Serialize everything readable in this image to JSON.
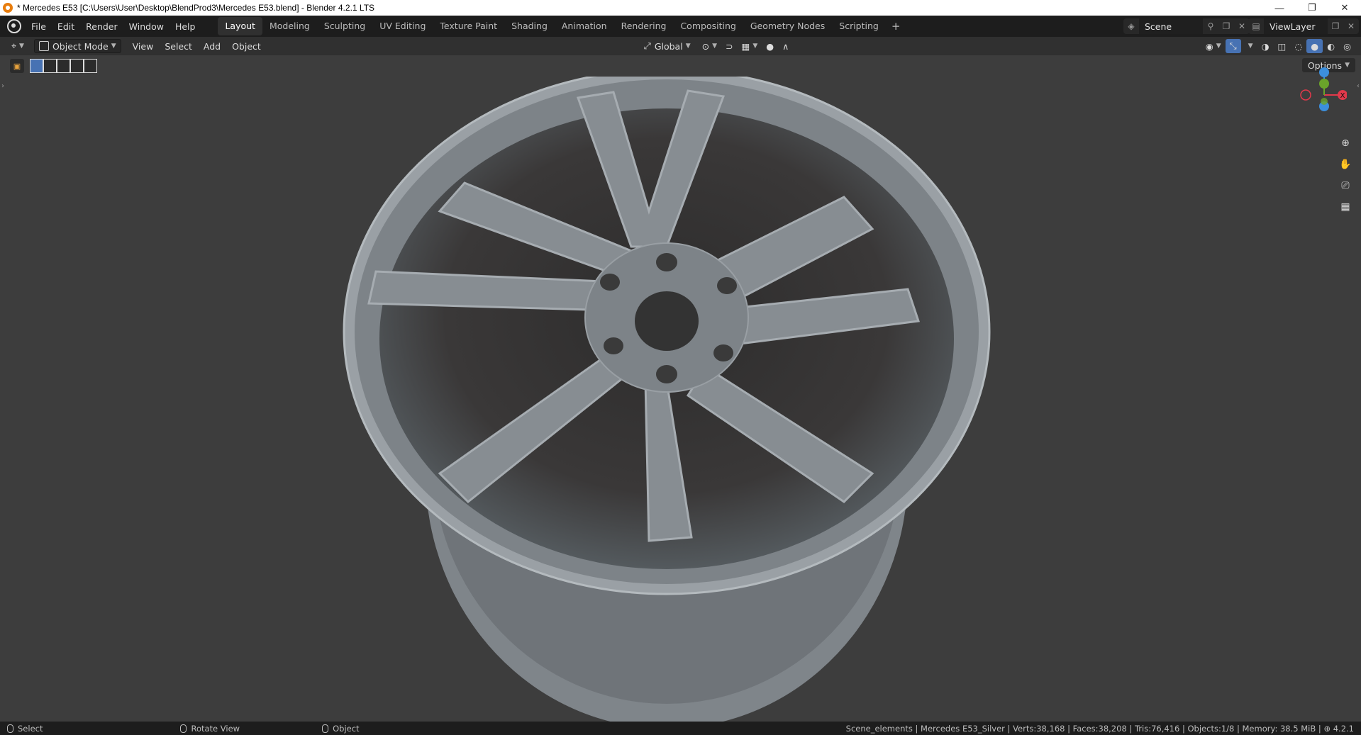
{
  "window": {
    "title": "* Mercedes E53 [C:\\Users\\User\\Desktop\\BlendProd3\\Mercedes E53.blend] - Blender 4.2.1 LTS",
    "controls": [
      "—",
      "❐",
      "✕"
    ]
  },
  "menu": {
    "items": [
      "File",
      "Edit",
      "Render",
      "Window",
      "Help"
    ]
  },
  "workspaces": {
    "tabs": [
      "Layout",
      "Modeling",
      "Sculpting",
      "UV Editing",
      "Texture Paint",
      "Shading",
      "Animation",
      "Rendering",
      "Compositing",
      "Geometry Nodes",
      "Scripting"
    ],
    "active": "Layout",
    "add": "+"
  },
  "scene": {
    "name": "Scene"
  },
  "view_layer": {
    "name": "ViewLayer"
  },
  "header": {
    "mode": "Object Mode",
    "menus": [
      "View",
      "Select",
      "Add",
      "Object"
    ],
    "transform_orientation": "Global"
  },
  "viewport": {
    "options_label": "Options",
    "background_color": "#3d3d3d",
    "wheel_color": "#8a9096",
    "axes": {
      "x_color": "#e2394b",
      "y_color": "#6aa42a",
      "z_color": "#3c8fdc",
      "x_label": "X"
    }
  },
  "status": {
    "hints": [
      "Select",
      "Rotate View",
      "Object"
    ],
    "stats": "Scene_elements | Mercedes E53_Silver | Verts:38,168 | Faces:38,208 | Tris:76,416 | Objects:1/8 | Memory: 38.5 MiB | ",
    "version": "4.2.1"
  }
}
